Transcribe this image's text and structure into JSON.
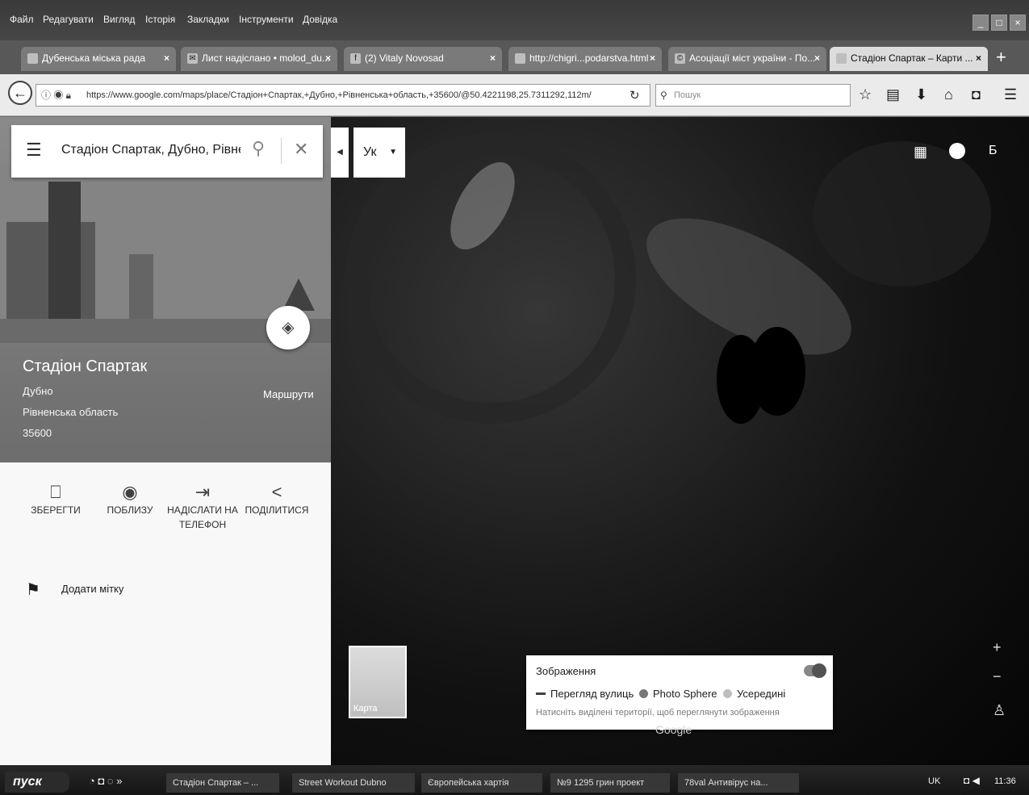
{
  "browser": {
    "menu": [
      "Файл",
      "Редагувати",
      "Вигляд",
      "Історія",
      "Закладки",
      "Інструменти",
      "Довідка"
    ],
    "tabs": [
      {
        "label": "Дубенська міська рада"
      },
      {
        "label": "Лист надіслано • molod_du..."
      },
      {
        "label": "(2) Vitaly Novosad"
      },
      {
        "label": "http://chigri...podarstva.html"
      },
      {
        "label": "Асоціації міст україни - По..."
      },
      {
        "label": "Стадіон Спартак – Карти ..."
      }
    ],
    "url": "https://www.google.com/maps/place/Стадіон+Спартак,+Дубно,+Рівненська+область,+35600/@50.4221198,25.7311292,112m/",
    "search_placeholder": "Пошук"
  },
  "maps": {
    "search_value": "Стадіон Спартак, Дубно, Рівненська область",
    "language_button": "Ук",
    "account_initial": "Б",
    "place": {
      "title": "Стадіон Спартак",
      "city": "Дубно",
      "region": "Рівненська область",
      "postcode": "35600",
      "routes_label": "Маршрути"
    },
    "actions": [
      {
        "label": "ЗБЕРЕГТИ",
        "icon": "bookmark-icon"
      },
      {
        "label": "ПОБЛИЗУ",
        "icon": "nearby-icon"
      },
      {
        "label": "НАДІСЛАТИ НА ТЕЛЕФОН",
        "icon": "send-to-phone-icon"
      },
      {
        "label": "ПОДІЛИТИСЯ",
        "icon": "share-icon"
      }
    ],
    "add_label": "Додати мітку",
    "imagery": {
      "title": "Зображення",
      "legend": [
        "Перегляд вулиць",
        "Photo Sphere",
        "Усередині"
      ],
      "hint": "Натисніть виділені території, щоб переглянути зображення"
    },
    "map_thumb_label": "Карта",
    "logo": "Google"
  },
  "taskbar": {
    "start": "пуск",
    "tasks": [
      "Стадіон Спартак – ...",
      "Street Workout Dubno",
      "Європейська хартія",
      "№9 1295 грин проект",
      "78val Антивірус на..."
    ],
    "lang": "UK",
    "clock": "11:36"
  }
}
